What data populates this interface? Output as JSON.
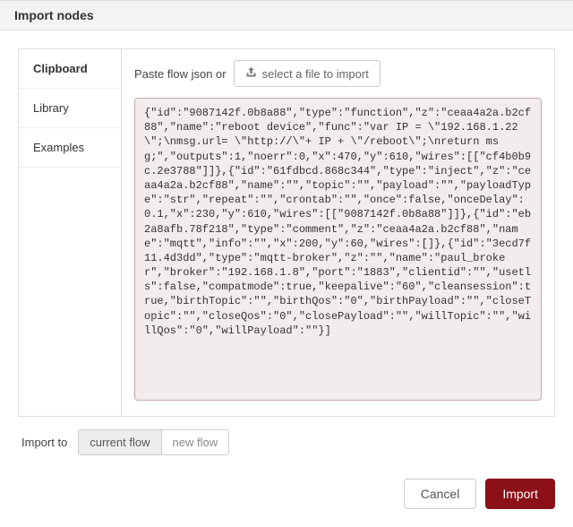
{
  "dialog": {
    "title": "Import nodes"
  },
  "sidebar": {
    "items": [
      {
        "label": "Clipboard",
        "active": true
      },
      {
        "label": "Library",
        "active": false
      },
      {
        "label": "Examples",
        "active": false
      }
    ]
  },
  "content": {
    "paste_label": "Paste flow json or",
    "file_button": "select a file to import",
    "json_text": "{\"id\":\"9087142f.0b8a88\",\"type\":\"function\",\"z\":\"ceaa4a2a.b2cf88\",\"name\":\"reboot device\",\"func\":\"var IP = \\\"192.168.1.22\\\";\\nmsg.url= \\\"http://\\\"+ IP + \\\"/reboot\\\";\\nreturn msg;\",\"outputs\":1,\"noerr\":0,\"x\":470,\"y\":610,\"wires\":[[\"cf4b0b9c.2e3788\"]]},{\"id\":\"61fdbcd.868c344\",\"type\":\"inject\",\"z\":\"ceaa4a2a.b2cf88\",\"name\":\"\",\"topic\":\"\",\"payload\":\"\",\"payloadType\":\"str\",\"repeat\":\"\",\"crontab\":\"\",\"once\":false,\"onceDelay\":0.1,\"x\":230,\"y\":610,\"wires\":[[\"9087142f.0b8a88\"]]},{\"id\":\"eb2a8afb.78f218\",\"type\":\"comment\",\"z\":\"ceaa4a2a.b2cf88\",\"name\":\"mqtt\",\"info\":\"\",\"x\":200,\"y\":60,\"wires\":[]},{\"id\":\"3ecd7f11.4d3dd\",\"type\":\"mqtt-broker\",\"z\":\"\",\"name\":\"paul_broker\",\"broker\":\"192.168.1.8\",\"port\":\"1883\",\"clientid\":\"\",\"usetls\":false,\"compatmode\":true,\"keepalive\":\"60\",\"cleansession\":true,\"birthTopic\":\"\",\"birthQos\":\"0\",\"birthPayload\":\"\",\"closeTopic\":\"\",\"closeQos\":\"0\",\"closePayload\":\"\",\"willTopic\":\"\",\"willQos\":\"0\",\"willPayload\":\"\"}]"
  },
  "import_to": {
    "label": "Import to",
    "options": [
      {
        "label": "current flow",
        "selected": true
      },
      {
        "label": "new flow",
        "selected": false
      }
    ]
  },
  "footer": {
    "cancel": "Cancel",
    "import": "Import"
  }
}
